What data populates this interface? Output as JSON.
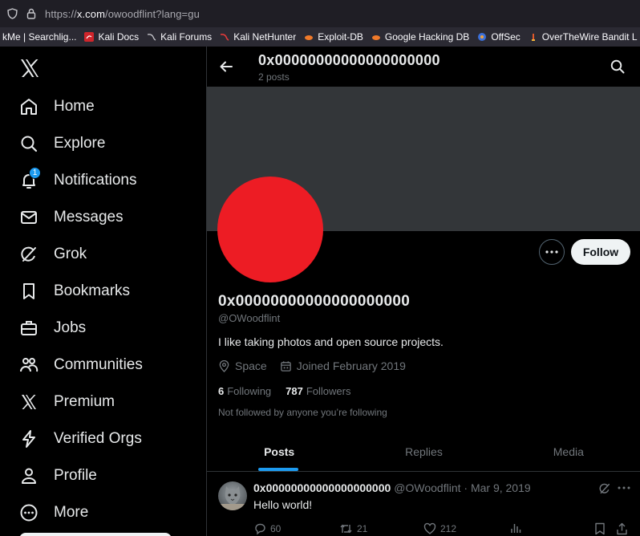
{
  "browser": {
    "url_prefix": "https://",
    "url_domain": "x.com",
    "url_path": "/owoodflint?lang=gu",
    "bookmarks": [
      {
        "label": "kMe | Searchlig...",
        "icon": "none"
      },
      {
        "label": "Kali Docs",
        "icon": "kali-docs-icon"
      },
      {
        "label": "Kali Forums",
        "icon": "kali-icon"
      },
      {
        "label": "Kali NetHunter",
        "icon": "nethunter-icon"
      },
      {
        "label": "Exploit-DB",
        "icon": "exploitdb-icon"
      },
      {
        "label": "Google Hacking DB",
        "icon": "exploitdb-icon"
      },
      {
        "label": "OffSec",
        "icon": "offsec-icon"
      },
      {
        "label": "OverTheWire Bandit L",
        "icon": "otw-icon"
      }
    ]
  },
  "sidebar": {
    "items": [
      {
        "label": "Home",
        "icon": "home-icon"
      },
      {
        "label": "Explore",
        "icon": "search-icon"
      },
      {
        "label": "Notifications",
        "icon": "bell-icon",
        "badge": "1"
      },
      {
        "label": "Messages",
        "icon": "envelope-icon"
      },
      {
        "label": "Grok",
        "icon": "grok-icon"
      },
      {
        "label": "Bookmarks",
        "icon": "bookmark-icon"
      },
      {
        "label": "Jobs",
        "icon": "briefcase-icon"
      },
      {
        "label": "Communities",
        "icon": "people-icon"
      },
      {
        "label": "Premium",
        "icon": "x-icon"
      },
      {
        "label": "Verified Orgs",
        "icon": "lightning-icon"
      },
      {
        "label": "Profile",
        "icon": "person-icon"
      },
      {
        "label": "More",
        "icon": "more-circle-icon"
      }
    ]
  },
  "header": {
    "title": "0x00000000000000000000",
    "posts_count": "2 posts"
  },
  "profile": {
    "name": "0x00000000000000000000",
    "handle": "@OWoodflint",
    "bio": "I like taking photos and open source projects.",
    "location": "Space",
    "joined": "Joined February 2019",
    "following_count": "6",
    "following_label": "Following",
    "followers_count": "787",
    "followers_label": "Followers",
    "note": "Not followed by anyone you’re following",
    "follow_label": "Follow",
    "avatar_color": "#ed1c24"
  },
  "tabs": [
    "Posts",
    "Replies",
    "Media"
  ],
  "tweet": {
    "name": "0x00000000000000000000",
    "meta": "@OWoodflint · Mar 9, 2019",
    "text": "Hello world!",
    "replies": "60",
    "reposts": "21",
    "likes": "212"
  },
  "colors": {
    "accent": "#1d9bf0",
    "background": "#000000",
    "banner": "#333639"
  }
}
